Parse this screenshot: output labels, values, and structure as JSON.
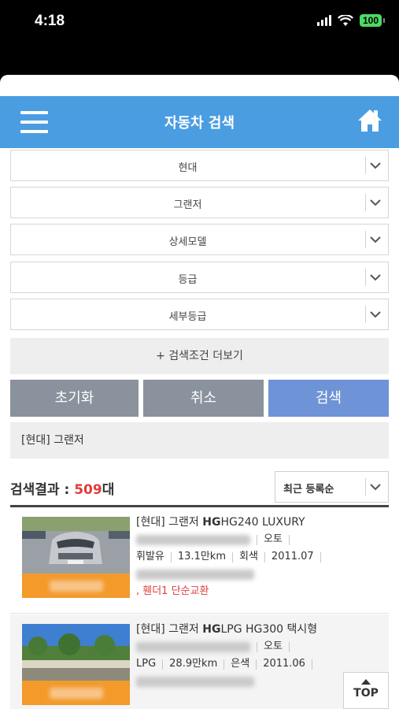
{
  "status_bar": {
    "time": "4:18",
    "battery": "100"
  },
  "header": {
    "title": "자동차 검색",
    "menu_icon": "hamburger-icon",
    "home_icon": "home-icon"
  },
  "filters": [
    {
      "value": "현대"
    },
    {
      "value": "그랜저"
    },
    {
      "value": "상세모델"
    },
    {
      "value": "등급"
    },
    {
      "value": "세부등급"
    }
  ],
  "more_conditions": "+ 검색조건 더보기",
  "actions": {
    "reset": "초기화",
    "cancel": "취소",
    "search": "검색"
  },
  "condition_summary": "[현대] 그랜저",
  "results": {
    "label": "검색결과 : ",
    "count": "509",
    "unit": "대",
    "sort": "최근 등록순"
  },
  "listings": [
    {
      "title_prefix": "[현대] 그랜저 ",
      "title_bold": "HG",
      "title_suffix": "HG240 LUXURY",
      "transmission": "오토",
      "fuel": "휘발유",
      "mileage": "13.1만km",
      "color": "회색",
      "year": "2011.07",
      "note": ", 휀더1 단순교환"
    },
    {
      "title_prefix": "[현대] 그랜저 ",
      "title_bold": "HG",
      "title_suffix": "LPG HG300 택시형",
      "transmission": "오토",
      "fuel": "LPG",
      "mileage": "28.9만km",
      "color": "은색",
      "year": "2011.06",
      "note": ""
    }
  ],
  "top_button": "TOP",
  "colors": {
    "header": "#4a9de0",
    "accent_red": "#e03b3b",
    "search_button": "#6e93d6",
    "gray_button": "#8a929d",
    "thumb_orange": "#f39a2b"
  }
}
